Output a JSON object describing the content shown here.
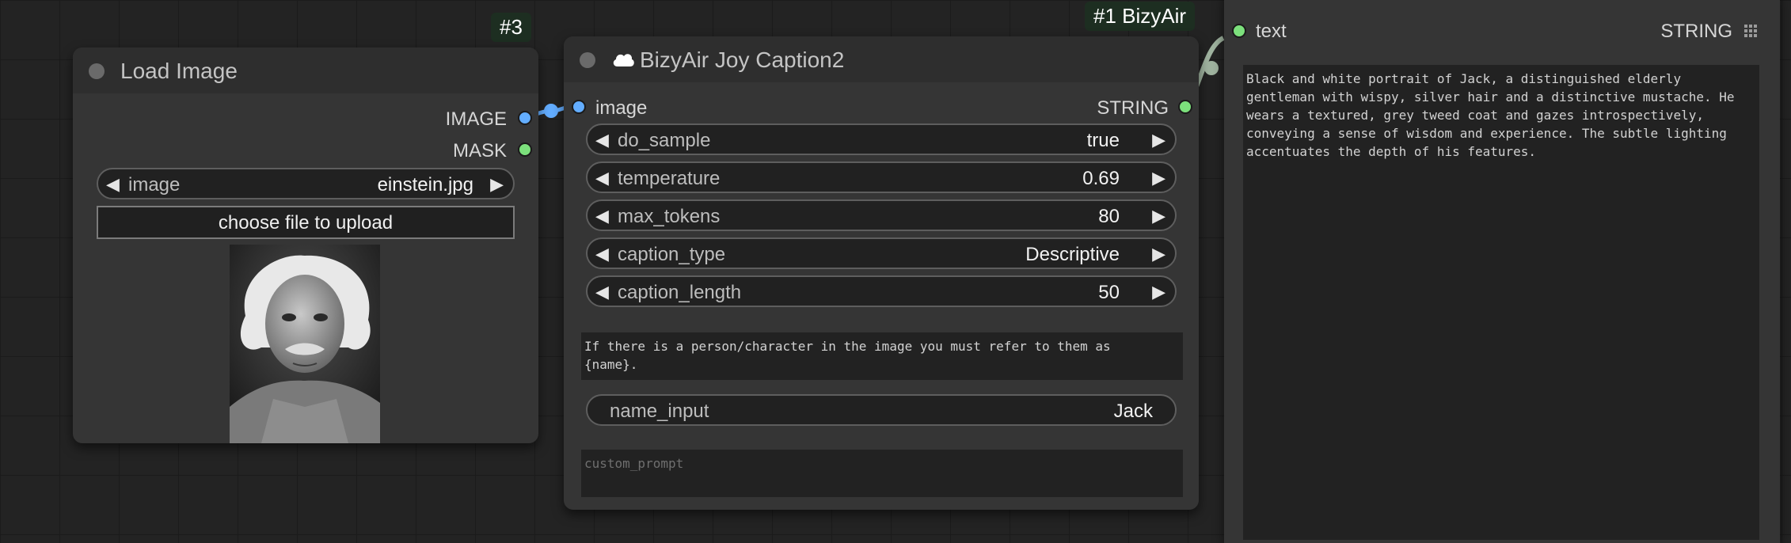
{
  "load_image_node": {
    "badge": "#3",
    "title": "Load Image",
    "outputs": [
      {
        "label": "IMAGE",
        "color": "#63adff"
      },
      {
        "label": "MASK",
        "color": "#7ce07c"
      }
    ],
    "image_widget": {
      "label": "image",
      "value": "einstein.jpg"
    },
    "upload_button": "choose file to upload",
    "preview_icon": "portrait-photo-icon"
  },
  "joy_caption_node": {
    "badge": "#1 BizyAir",
    "title_icon": "cloud-icon",
    "title": "BizyAir Joy Caption2",
    "input": {
      "label": "image",
      "color": "#63adff"
    },
    "output": {
      "label": "STRING",
      "color": "#7ce07c"
    },
    "widgets": [
      {
        "label": "do_sample",
        "value": "true"
      },
      {
        "label": "temperature",
        "value": "0.69"
      },
      {
        "label": "max_tokens",
        "value": "80"
      },
      {
        "label": "caption_type",
        "value": "Descriptive"
      },
      {
        "label": "caption_length",
        "value": "50"
      }
    ],
    "extra_prompt": "If there is a person/character in the image you must refer to them as\n{name}.",
    "name_input": {
      "label": "name_input",
      "value": "Jack"
    },
    "custom_prompt_placeholder": "custom_prompt"
  },
  "show_text_node": {
    "input": {
      "label": "text",
      "color": "#7ce07c"
    },
    "type_label": "STRING",
    "menu_icon": "grid-menu-icon",
    "text": "Black and white portrait of Jack, a distinguished elderly\ngentleman with wispy, silver hair and a distinctive mustache. He\nwears a textured, grey tweed coat and gazes introspectively,\nconveying a sense of wisdom and experience. The subtle lighting\naccentuates the depth of his features."
  }
}
